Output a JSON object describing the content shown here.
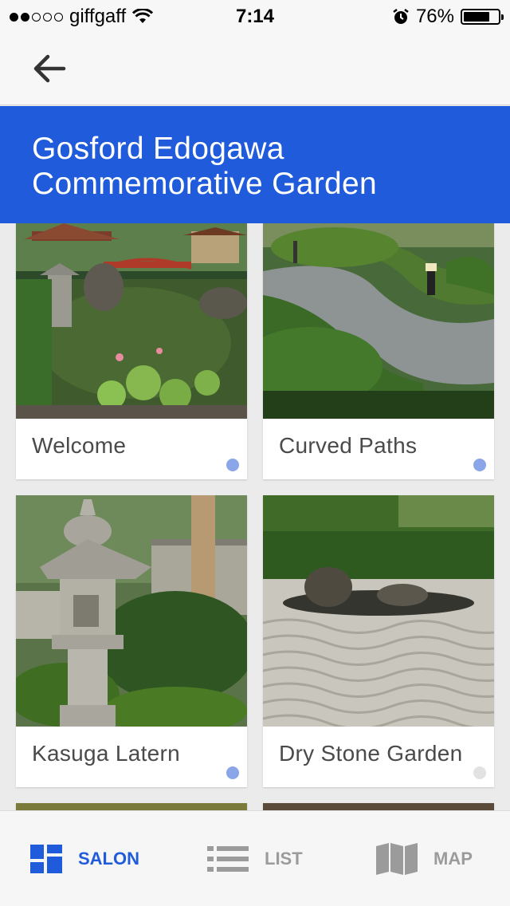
{
  "status_bar": {
    "carrier": "giffgaff",
    "time": "7:14",
    "battery": "76%",
    "battery_level": 0.76,
    "signal_bars_filled": 2,
    "signal_bars_total": 5
  },
  "header": {
    "back_icon": "arrow-left-icon",
    "title": "Gosford Edogawa Commemorative Garden",
    "accent_color": "#1f5bdb"
  },
  "cards": [
    {
      "label": "Welcome",
      "status": "unvisited",
      "dot_color": "#8aa5e8"
    },
    {
      "label": "Curved Paths",
      "status": "unvisited",
      "dot_color": "#8aa5e8"
    },
    {
      "label": "Kasuga Latern",
      "status": "unvisited",
      "dot_color": "#8aa5e8"
    },
    {
      "label": "Dry Stone Garden",
      "status": "visited",
      "dot_color": "#e2e2e2"
    }
  ],
  "tabs": [
    {
      "label": "SALON",
      "icon": "grid-icon",
      "active": true
    },
    {
      "label": "LIST",
      "icon": "list-icon",
      "active": false
    },
    {
      "label": "MAP",
      "icon": "map-icon",
      "active": false
    }
  ]
}
